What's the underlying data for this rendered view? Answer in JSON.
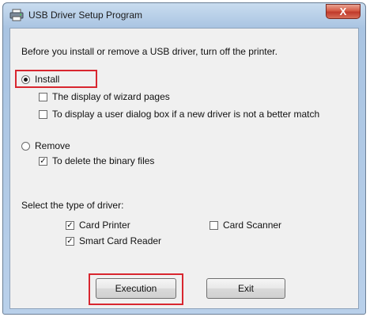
{
  "window": {
    "title": "USB Driver Setup Program",
    "close_glyph": "X"
  },
  "intro": "Before you install or remove a USB driver, turn off the printer.",
  "install": {
    "label": "Install",
    "options": [
      {
        "label": "The display of wizard pages",
        "checked": false
      },
      {
        "label": "To display a user dialog box if a new driver is not a better match",
        "checked": false
      }
    ]
  },
  "remove": {
    "label": "Remove",
    "options": [
      {
        "label": "To delete the binary files",
        "checked": true
      }
    ]
  },
  "driver_type": {
    "heading": "Select the type of driver:",
    "items": [
      {
        "label": "Card Printer",
        "checked": true
      },
      {
        "label": "Card Scanner",
        "checked": false
      },
      {
        "label": "Smart Card Reader",
        "checked": true
      }
    ]
  },
  "buttons": {
    "execute": "Execution",
    "exit": "Exit"
  },
  "selected_mode": "Install",
  "colors": {
    "highlight": "#d8262f",
    "title_close": "#c0392b"
  }
}
